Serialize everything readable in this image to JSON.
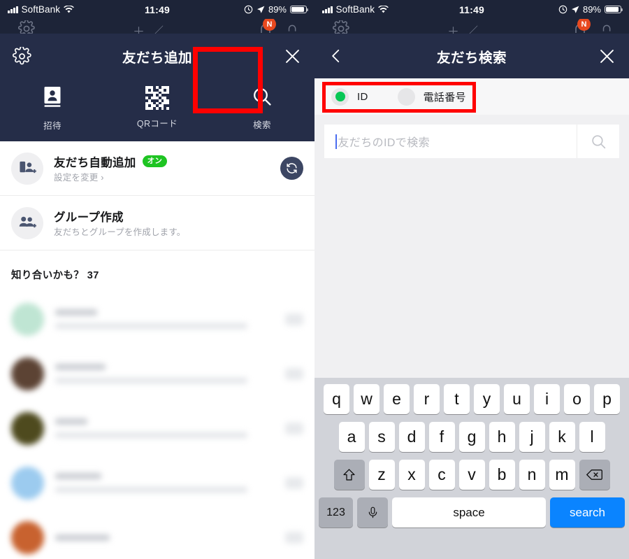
{
  "status_bar": {
    "carrier": "SoftBank",
    "time": "11:49",
    "battery_percent": "89%",
    "signal_icon": "signal-bars-icon",
    "wifi_icon": "wifi-icon",
    "alarm_icon": "alarm-icon",
    "location_icon": "location-arrow-icon",
    "battery_icon": "battery-icon"
  },
  "left_panel": {
    "header": {
      "title": "友だち追加",
      "settings_icon": "gear-icon",
      "close_icon": "close-icon"
    },
    "tabs": [
      {
        "label": "招待",
        "icon": "contact-card-icon",
        "highlighted": false
      },
      {
        "label": "QRコード",
        "icon": "qr-code-icon",
        "highlighted": false
      },
      {
        "label": "検索",
        "icon": "search-icon",
        "highlighted": true
      }
    ],
    "rows": [
      {
        "title": "友だち自動追加",
        "badge": "オン",
        "subtitle": "設定を変更 ",
        "subtitle_chevron": "›",
        "icon": "phone-add-friend-icon",
        "action_icon": "sync-icon"
      },
      {
        "title": "グループ作成",
        "badge": "",
        "subtitle": "友だちとグループを作成します。",
        "icon": "group-add-icon",
        "action_icon": ""
      }
    ],
    "suggestions": {
      "heading": "知り合いかも？ 37",
      "items": [
        {
          "avatar_color": "#bfe5d3"
        },
        {
          "avatar_color": "#5c4334"
        },
        {
          "avatar_color": "#4e4a1e"
        },
        {
          "avatar_color": "#9ccbef"
        },
        {
          "avatar_color": "#c8622f"
        }
      ]
    }
  },
  "right_panel": {
    "header": {
      "title": "友だち検索",
      "back_icon": "chevron-left-icon",
      "close_icon": "close-icon"
    },
    "search_mode": {
      "highlighted": true,
      "options": [
        {
          "label": "ID",
          "selected": true
        },
        {
          "label": "電話番号",
          "selected": false
        }
      ],
      "selected_color": "#06c755"
    },
    "search_field": {
      "value": "",
      "placeholder": "友だちのIDで検索",
      "search_icon": "search-icon",
      "caret_color": "#4a6cf0"
    },
    "keyboard": {
      "row1": [
        "q",
        "w",
        "e",
        "r",
        "t",
        "y",
        "u",
        "i",
        "o",
        "p"
      ],
      "row2": [
        "a",
        "s",
        "d",
        "f",
        "g",
        "h",
        "j",
        "k",
        "l"
      ],
      "row3": [
        "z",
        "x",
        "c",
        "v",
        "b",
        "n",
        "m"
      ],
      "shift_key": "shift-icon",
      "backspace_key": "backspace-icon",
      "numbers_key": "123",
      "mic_key": "microphone-icon",
      "space_key": "space",
      "return_key": "search",
      "return_color": "#0a84ff"
    }
  },
  "annotation": {
    "highlight_color": "#ff0000"
  }
}
